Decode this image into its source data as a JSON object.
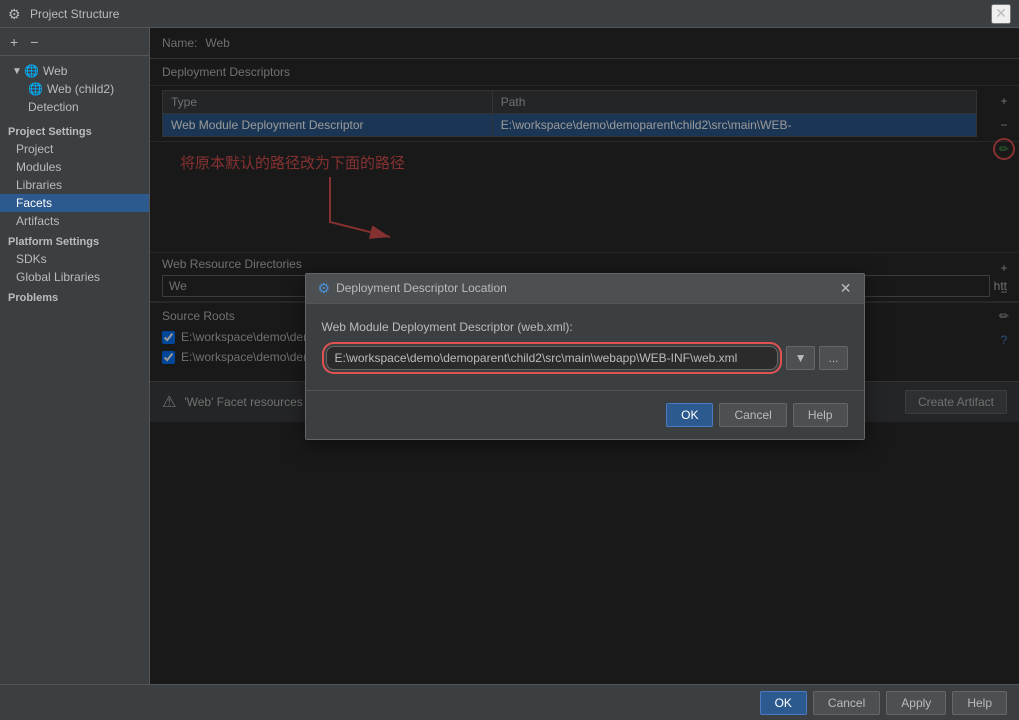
{
  "window": {
    "title": "Project Structure",
    "icon": "⚙"
  },
  "sidebar": {
    "toolbar": {
      "add_label": "+",
      "remove_label": "−"
    },
    "project_settings_label": "Project Settings",
    "items": [
      {
        "id": "project",
        "label": "Project",
        "indent": 0,
        "selected": false
      },
      {
        "id": "modules",
        "label": "Modules",
        "indent": 0,
        "selected": false
      },
      {
        "id": "libraries",
        "label": "Libraries",
        "indent": 0,
        "selected": false
      },
      {
        "id": "facets",
        "label": "Facets",
        "indent": 0,
        "selected": true
      },
      {
        "id": "artifacts",
        "label": "Artifacts",
        "indent": 0,
        "selected": false
      }
    ],
    "platform_settings_label": "Platform Settings",
    "platform_items": [
      {
        "id": "sdks",
        "label": "SDKs",
        "indent": 0
      },
      {
        "id": "global-libraries",
        "label": "Global Libraries",
        "indent": 0
      }
    ],
    "problems_label": "Problems",
    "tree": {
      "web_label": "Web",
      "web_child_label": "Web (child2)",
      "detection_label": "Detection"
    }
  },
  "right_panel": {
    "name_label": "Name:",
    "name_value": "Web",
    "deployment_descriptors_label": "Deployment Descriptors",
    "table": {
      "columns": [
        "Type",
        "Path"
      ],
      "rows": [
        {
          "type": "Web Module Deployment Descriptor",
          "path": "E:\\workspace\\demo\\demoparent\\child2\\src\\main\\WEB-"
        }
      ]
    },
    "annotation_text": "将原本默认的路径改为下面的路径",
    "web_resource_directories_label": "Web Resource Directories",
    "web_root": "We",
    "web_root_path": "htt",
    "source_roots_label": "Source Roots",
    "source_roots": [
      {
        "path": "E:\\workspace\\demo\\demoparent\\child2\\src\\main\\java",
        "checked": true
      },
      {
        "path": "E:\\workspace\\demo\\demoparent\\child2\\src\\main\\resources",
        "checked": true
      }
    ],
    "warning_text": "'Web' Facet resources are not included in an artifact",
    "create_artifact_btn": "Create Artifact"
  },
  "modal": {
    "title": "Deployment Descriptor Location",
    "icon": "⚙",
    "label": "Web Module Deployment Descriptor (web.xml):",
    "input_value": "E:\\workspace\\demo\\demoparent\\child2\\src\\main\\webapp\\WEB-INF\\web.xml",
    "ok_label": "OK",
    "cancel_label": "Cancel",
    "help_label": "Help"
  },
  "bottom_bar": {
    "ok_label": "OK",
    "cancel_label": "Cancel",
    "apply_label": "Apply",
    "help_label": "Help"
  }
}
